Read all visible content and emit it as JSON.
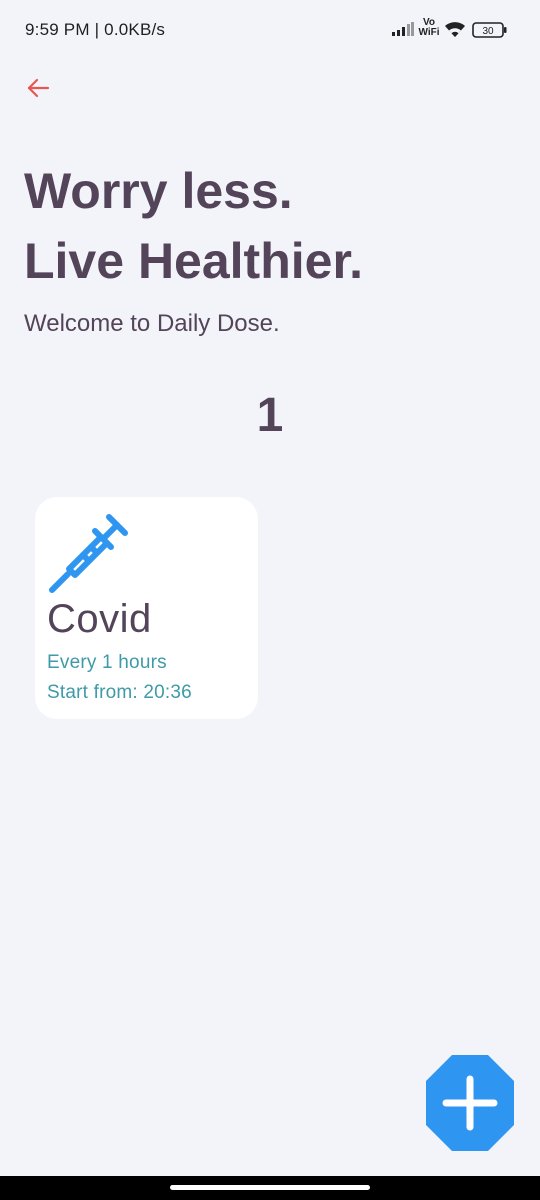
{
  "status_bar": {
    "time": "9:59 PM | 0.0KB/s",
    "vowifi_top": "Vo",
    "vowifi_bottom": "WiFi",
    "battery": "30"
  },
  "header": {
    "back_icon": "arrow-left-icon",
    "headline_line1": "Worry less.",
    "headline_line2": "Live Healthier.",
    "subtitle": "Welcome to Daily Dose."
  },
  "medicine_count": "1",
  "medicines": [
    {
      "icon": "syringe-icon",
      "name": "Covid",
      "interval": "Every 1 hours",
      "start": "Start from: 20:36"
    }
  ],
  "fab": {
    "icon": "plus-icon"
  },
  "colors": {
    "background": "#f3f4f9",
    "primary_text": "#534459",
    "accent_blue": "#2e96f0",
    "teal_text": "#3f9aa8",
    "back_arrow": "#e8574f"
  }
}
